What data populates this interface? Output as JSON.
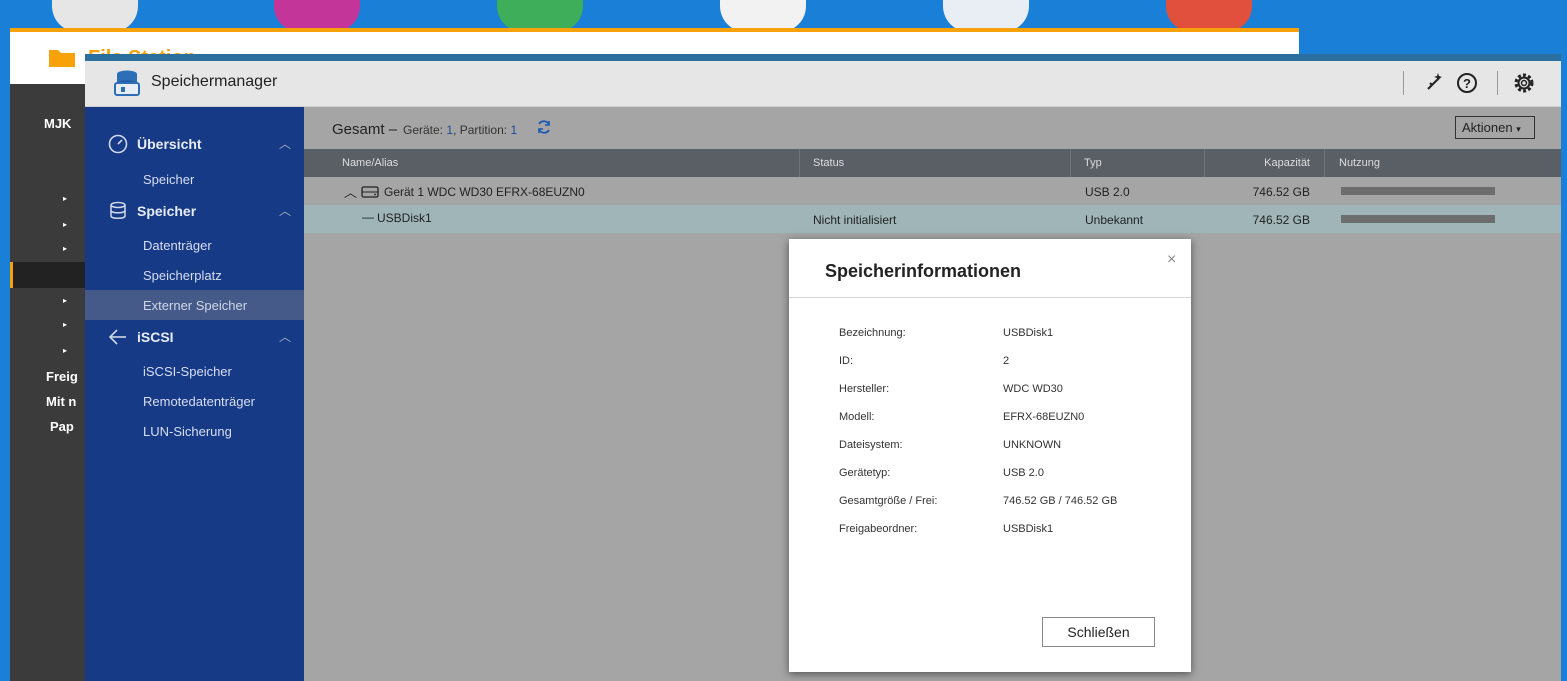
{
  "colors": {
    "desktop": "#1a7fd6",
    "nav": "#163a86",
    "accent": "#f7a20a"
  },
  "filestation": {
    "title": "File Station",
    "sidebar": [
      "MJK",
      "Freig",
      "Mit n",
      "Pap"
    ]
  },
  "app": {
    "title": "Speichermanager",
    "header_icons": [
      "magic-wand-icon",
      "help-icon",
      "settings-gear-icon"
    ]
  },
  "nav": {
    "groups": [
      {
        "label": "Übersicht",
        "icon": "dashboard-icon",
        "items": [
          "Speicher"
        ]
      },
      {
        "label": "Speicher",
        "icon": "database-icon",
        "items": [
          "Datenträger",
          "Speicherplatz",
          "Externer Speicher"
        ]
      },
      {
        "label": "iSCSI",
        "icon": "iscsi-icon",
        "items": [
          "iSCSI-Speicher",
          "Remotedatenträger",
          "LUN-Sicherung"
        ]
      }
    ],
    "active_item": "Externer Speicher"
  },
  "summary": {
    "title": "Gesamt",
    "dash": "–",
    "devices_label": "Geräte:",
    "devices": "1",
    "partition_label": "Partition:",
    "partition": "1",
    "actions_label": "Aktionen"
  },
  "table": {
    "columns": [
      "Name/Alias",
      "Status",
      "Typ",
      "Kapazität",
      "Nutzung"
    ],
    "rows": [
      {
        "name": "Gerät 1 WDC WD30 EFRX-68EUZN0",
        "status": "",
        "type": "USB 2.0",
        "capacity": "746.52 GB",
        "usage": 1.0
      },
      {
        "name": "USBDisk1",
        "status": "Nicht initialisiert",
        "type": "Unbekannt",
        "capacity": "746.52 GB",
        "usage": 1.0
      }
    ]
  },
  "dialog": {
    "title": "Speicherinformationen",
    "close_label": "×",
    "fields": [
      {
        "label": "Bezeichnung:",
        "value": "USBDisk1"
      },
      {
        "label": "ID:",
        "value": "2"
      },
      {
        "label": "Hersteller:",
        "value": "WDC WD30"
      },
      {
        "label": "Modell:",
        "value": "EFRX-68EUZN0"
      },
      {
        "label": "Dateisystem:",
        "value": "UNKNOWN"
      },
      {
        "label": "Gerätetyp:",
        "value": "USB 2.0"
      },
      {
        "label": "Gesamtgröße / Frei:",
        "value": "746.52 GB / 746.52 GB"
      },
      {
        "label": "Freigabeordner:",
        "value": "USBDisk1"
      }
    ],
    "button_label": "Schließen"
  }
}
